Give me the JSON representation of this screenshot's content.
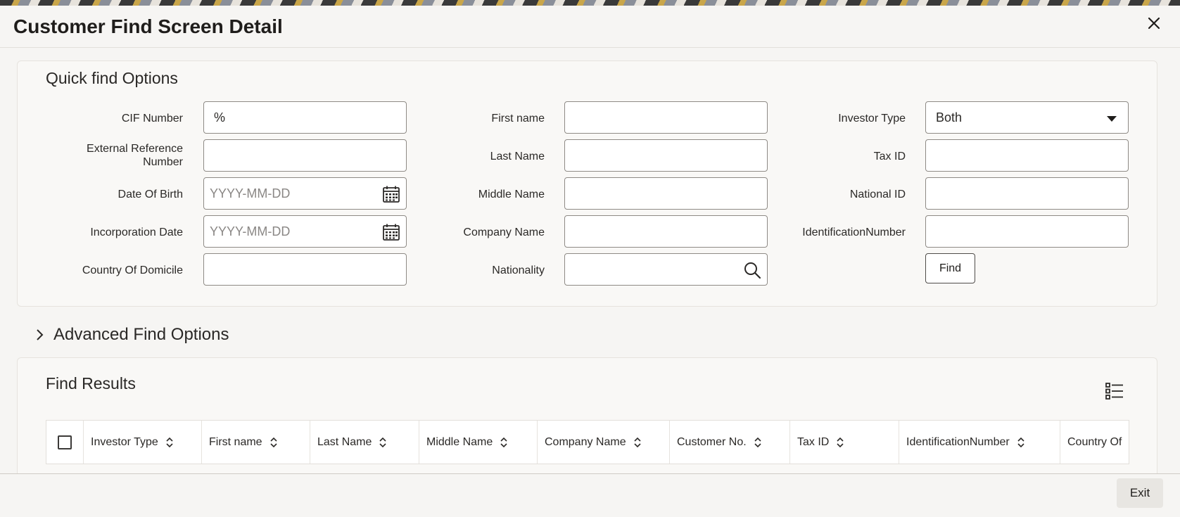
{
  "window": {
    "title": "Customer Find Screen Detail"
  },
  "quick_find": {
    "title": "Quick find Options",
    "fields": {
      "cif_number": {
        "label": "CIF Number",
        "value": "%"
      },
      "external_reference": {
        "label_line1": "External Reference",
        "label_line2": "Number",
        "value": ""
      },
      "date_of_birth": {
        "label": "Date Of Birth",
        "placeholder": "YYYY-MM-DD"
      },
      "incorporation_date": {
        "label": "Incorporation Date",
        "placeholder": "YYYY-MM-DD"
      },
      "country_of_domicile": {
        "label": "Country Of Domicile",
        "value": ""
      },
      "first_name": {
        "label": "First name",
        "value": ""
      },
      "last_name": {
        "label": "Last Name",
        "value": ""
      },
      "middle_name": {
        "label": "Middle Name",
        "value": ""
      },
      "company_name": {
        "label": "Company Name",
        "value": ""
      },
      "nationality": {
        "label": "Nationality",
        "value": ""
      },
      "investor_type": {
        "label": "Investor Type",
        "value": "Both"
      },
      "tax_id": {
        "label": "Tax ID",
        "value": ""
      },
      "national_id": {
        "label": "National ID",
        "value": ""
      },
      "identification_number": {
        "label": "IdentificationNumber",
        "value": ""
      }
    },
    "find_label": "Find"
  },
  "advanced": {
    "label": "Advanced Find Options"
  },
  "results": {
    "title": "Find Results",
    "columns": [
      "Investor Type",
      "First name",
      "Last Name",
      "Middle Name",
      "Company Name",
      "Customer No.",
      "Tax ID",
      "IdentificationNumber",
      "Country Of"
    ]
  },
  "footer": {
    "exit_label": "Exit"
  },
  "icons": {
    "close": "close-icon",
    "calendar": "calendar-icon",
    "search": "search-icon",
    "chevron": "chevron-right-icon",
    "sort": "sort-icon",
    "list": "column-list-icon"
  }
}
